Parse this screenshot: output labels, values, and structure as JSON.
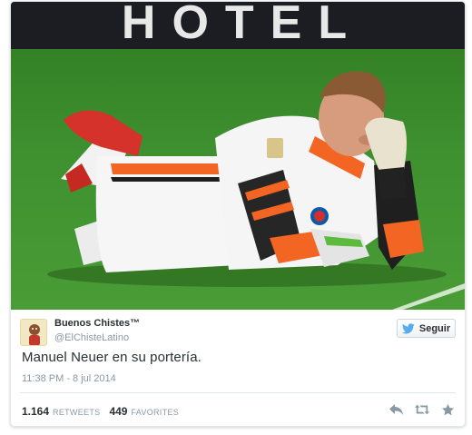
{
  "tweet": {
    "display_name": "Buenos Chistes™",
    "handle": "@ElChisteLatino",
    "text": "Manuel Neuer en su portería.",
    "timestamp": "11:38 PM - 8 jul 2014",
    "follow_label": "Seguir",
    "retweets": {
      "count": "1.164",
      "label": "RETWEETS"
    },
    "favorites": {
      "count": "449",
      "label": "FAVORITES"
    }
  },
  "photo": {
    "banner_text": "HOTEL"
  },
  "icons": {
    "follow": "twitter-bird-icon",
    "reply": "reply-icon",
    "retweet": "retweet-icon",
    "favorite": "star-icon"
  },
  "colors": {
    "accent": "#55acee",
    "grass": "#3f8f2a",
    "kit_white": "#f4f4f4",
    "kit_orange": "#f26522",
    "icon_gray": "#8899a6"
  }
}
